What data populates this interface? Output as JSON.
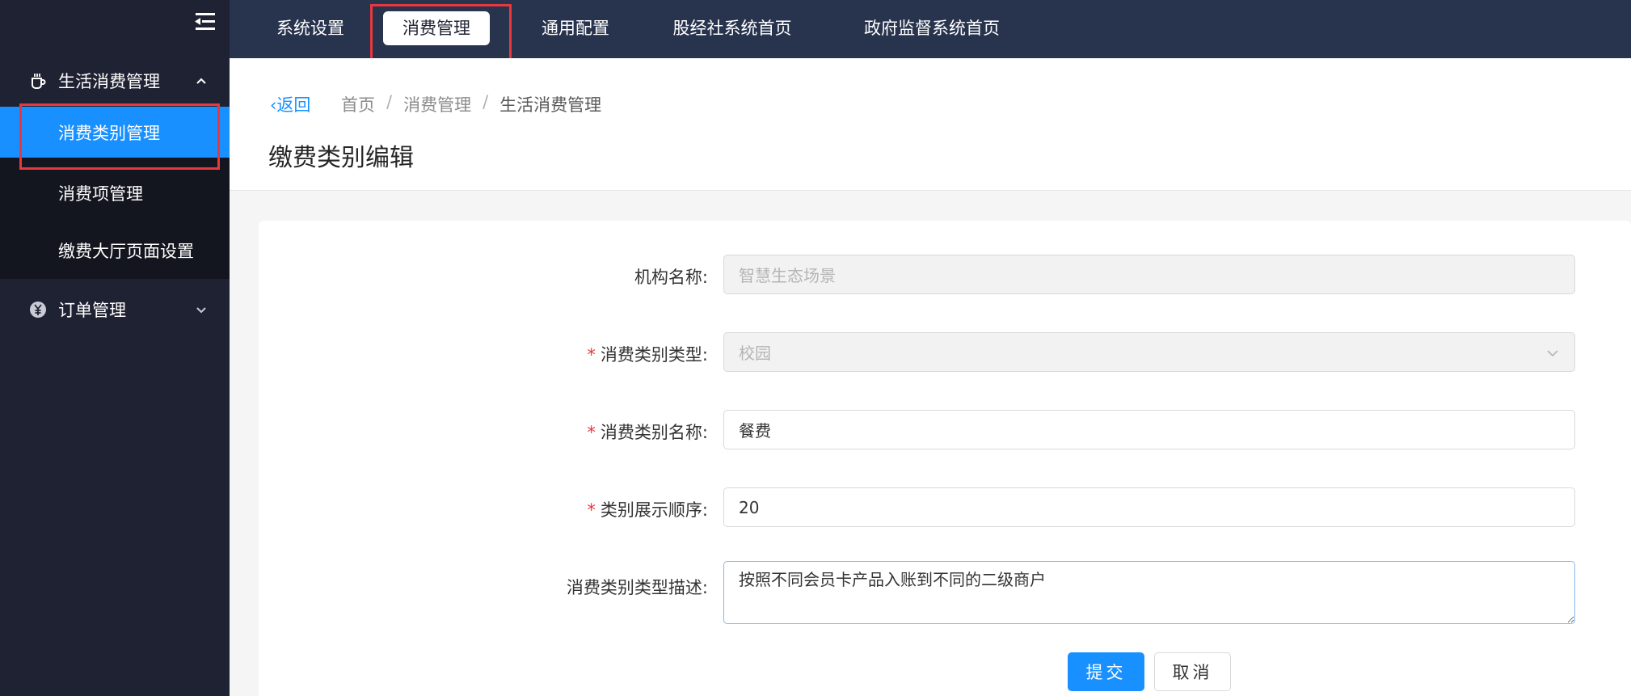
{
  "sidebar": {
    "group_life": "生活消费管理",
    "sub_items": [
      {
        "label": "消费类别管理",
        "active": true
      },
      {
        "label": "消费项管理",
        "active": false
      },
      {
        "label": "缴费大厅页面设置",
        "active": false
      }
    ],
    "group_order": "订单管理"
  },
  "topnav": {
    "items": [
      {
        "label": "系统设置"
      },
      {
        "label": "消费管理"
      },
      {
        "label": "通用配置"
      },
      {
        "label": "股经社系统首页"
      },
      {
        "label": "政府监督系统首页"
      }
    ]
  },
  "header": {
    "back": "返回",
    "breadcrumb": [
      "首页",
      "消费管理",
      "生活消费管理"
    ],
    "title": "缴费类别编辑"
  },
  "form": {
    "org_label": "机构名称:",
    "org_value": "智慧生态场景",
    "type_label": "消费类别类型:",
    "type_value": "校园",
    "name_label": "消费类别名称:",
    "name_value": "餐费",
    "order_label": "类别展示顺序:",
    "order_value": "20",
    "desc_label": "消费类别类型描述:",
    "desc_value": "按照不同会员卡产品入账到不同的二级商户",
    "submit": "提交",
    "cancel": "取消"
  },
  "colors": {
    "accent": "#1890ff",
    "sidebar_bg": "#1f2233",
    "topnav_bg": "#28334e",
    "highlight": "#e8383d",
    "required": "#e8383d"
  }
}
